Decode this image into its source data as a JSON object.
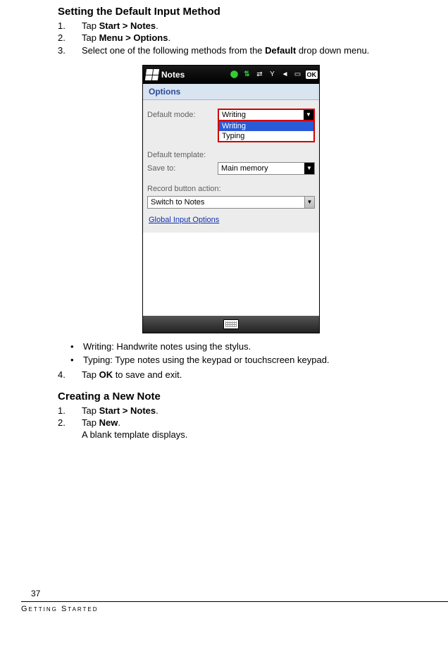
{
  "section1": {
    "heading": "Setting the Default Input Method",
    "step1_num": "1.",
    "step1_a": "Tap ",
    "step1_b": "Start > Notes",
    "step1_c": ".",
    "step2_num": "2.",
    "step2_a": "Tap ",
    "step2_b": "Menu > Options",
    "step2_c": ".",
    "step3_num": "3.",
    "step3_a": "Select one of the following methods from the ",
    "step3_b": "Default",
    "step3_c": " drop down menu."
  },
  "shot": {
    "app_title": "Notes",
    "ok": "OK",
    "subhead": "Options",
    "lbl_mode": "Default mode:",
    "lbl_template": "Default template:",
    "lbl_saveto": "Save to:",
    "mode_value": "Writing",
    "dd_writing": "Writing",
    "dd_typing": "Typing",
    "saveto_value": "Main memory",
    "record_lbl": "Record button action:",
    "record_value": "Switch to Notes",
    "link": "Global Input Options"
  },
  "bullets": {
    "b1": "Writing: Handwrite notes using the stylus.",
    "b2": "Typing: Type notes using the keypad or touchscreen keypad."
  },
  "section1b": {
    "step4_num": "4.",
    "step4_a": "Tap ",
    "step4_b": "OK",
    "step4_c": " to save and exit."
  },
  "section2": {
    "heading": "Creating a New Note",
    "step1_num": "1.",
    "step1_a": "Tap ",
    "step1_b": "Start > Notes",
    "step1_c": ".",
    "step2_num": "2.",
    "step2_a": "Tap ",
    "step2_b": "New",
    "step2_c": ".",
    "step2_line2": "A blank template displays."
  },
  "footer": {
    "page": "37",
    "chapter": "Getting Started"
  }
}
